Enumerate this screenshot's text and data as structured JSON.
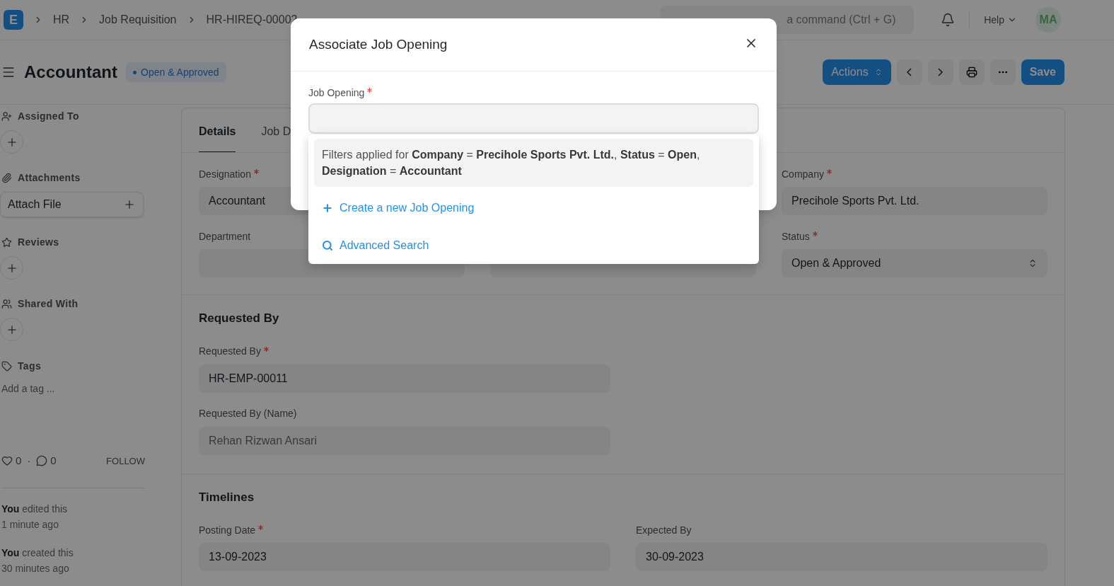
{
  "navbar": {
    "logo": "E",
    "breadcrumbs": [
      "HR",
      "Job Requisition",
      "HR-HIREQ-00002"
    ],
    "search": {
      "placeholder": "a command (Ctrl + G)"
    },
    "help": "Help",
    "avatar": "MA"
  },
  "header": {
    "title": "Accountant",
    "status": "Open & Approved",
    "actions": "Actions",
    "save": "Save"
  },
  "sidebar": {
    "assigned_to": "Assigned To",
    "attachments": "Attachments",
    "attach_file": "Attach File",
    "reviews": "Reviews",
    "shared_with": "Shared With",
    "tags": "Tags",
    "add_tag": "Add a tag ...",
    "likes": "0",
    "separator": "·",
    "comments": "0",
    "follow": "FOLLOW",
    "activity": [
      {
        "text": "**You** edited this",
        "time": "1 minute ago"
      },
      {
        "text": "**You** created this",
        "time": "30 minutes ago"
      }
    ]
  },
  "tabs": [
    {
      "label": "Details",
      "selected": true
    },
    {
      "label": "Job D",
      "selected": false
    }
  ],
  "details": {
    "columns": [
      [
        {
          "label": "Designation",
          "required": true,
          "value": "Accountant",
          "kind": "input"
        },
        {
          "label": "Department",
          "required": false,
          "kind": "input"
        }
      ],
      [
        {
          "kind": "hidden"
        },
        {
          "kind": "input"
        }
      ],
      [
        {
          "label": "Company",
          "required": true,
          "value": "Precihole Sports Pvt. Ltd.",
          "kind": "input"
        },
        {
          "label": "Status",
          "required": true,
          "value": "Open & Approved",
          "kind": "select"
        }
      ]
    ]
  },
  "sections": [
    {
      "title": "Requested By",
      "columns": [
        [
          {
            "label": "Requested By",
            "required": true,
            "value": "HR-EMP-00011",
            "kind": "input"
          },
          {
            "label": "Requested By (Name)",
            "required": false,
            "value": "Rehan Rizwan Ansari",
            "kind": "readonly"
          }
        ],
        []
      ]
    },
    {
      "title": "Timelines",
      "columns": [
        [
          {
            "label": "Posting Date",
            "required": true,
            "value": "13-09-2023",
            "kind": "input"
          }
        ],
        [
          {
            "label": "Expected By",
            "required": false,
            "value": "30-09-2023",
            "kind": "input"
          }
        ]
      ]
    }
  ],
  "dialog": {
    "title": "Associate Job Opening",
    "field_label": "Job Opening",
    "required": true,
    "dropdown": {
      "filters": "Filters applied for **Company** = **Precihole Sports Pvt. Ltd.**, **Status** = **Open**, **Designation** = **Accountant**",
      "create": "Create a new Job Opening",
      "advanced": "Advanced Search"
    }
  }
}
